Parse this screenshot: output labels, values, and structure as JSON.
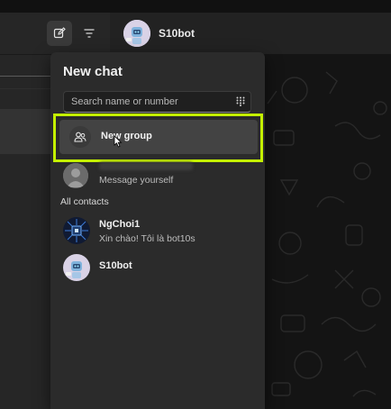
{
  "chat_header": {
    "title": "S10bot"
  },
  "new_chat_panel": {
    "title": "New chat",
    "search": {
      "placeholder": "Search name or number",
      "value": ""
    },
    "new_group_label": "New group",
    "self_entry": {
      "subtitle": "Message yourself"
    },
    "section_label": "All contacts",
    "contacts": [
      {
        "name": "NgChoi1",
        "message": "Xin chào! Tôi là bot10s",
        "avatar_icon": "chip-avatar-icon"
      },
      {
        "name": "S10bot",
        "message": "",
        "avatar_icon": "robot-avatar-icon"
      }
    ]
  },
  "colors": {
    "highlight": "#c4f000",
    "panel": "#2b2b2b",
    "row_hover": "#434343"
  }
}
